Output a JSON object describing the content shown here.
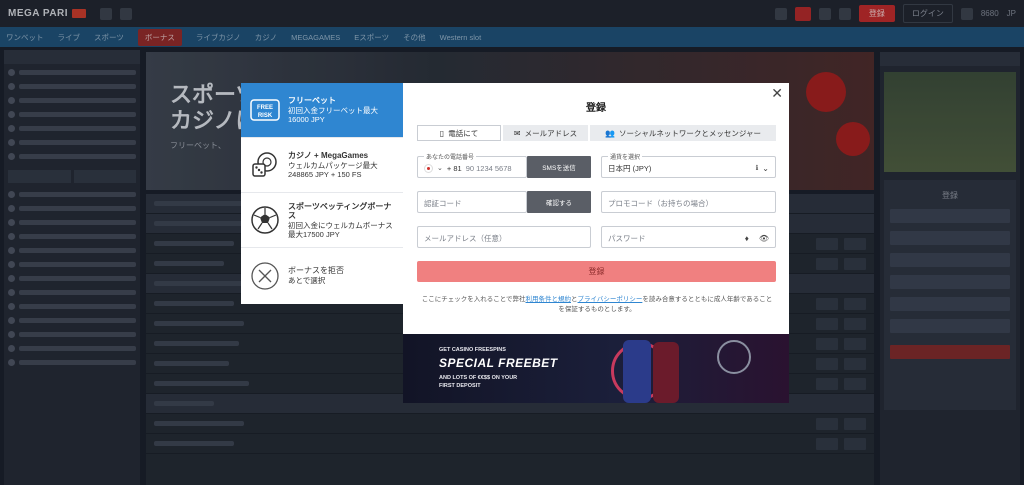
{
  "site": {
    "logo": "MEGA PARI",
    "topbar": {
      "register": "登録",
      "login": "ログイン",
      "currency": "8680",
      "lang": "JP"
    },
    "nav": [
      "ワンベット",
      "ライブ",
      "スポーツ",
      "ボーナス",
      "ライブカジノ",
      "カジノ",
      "MEGAGAMES",
      "Eスポーツ",
      "その他",
      "Western slot"
    ],
    "banner": {
      "title_line1": "スポーツ",
      "title_line2": "カジノに",
      "subtitle": "フリーベット、"
    },
    "right": {
      "title": "登録"
    }
  },
  "bonuses": [
    {
      "title": "フリーベット",
      "desc": "初回入金フリーベット最大 16000 JPY",
      "icon": "free-risk-icon"
    },
    {
      "title": "カジノ + MegaGames",
      "desc": "ウェルカムパッケージ最大 248865 JPY + 150 FS",
      "icon": "dice-chip-icon"
    },
    {
      "title": "スポーツベッティングボーナス",
      "desc": "初回入金にウェルカムボーナス最大17500 JPY",
      "icon": "soccer-ball-icon"
    },
    {
      "title": "ボーナスを拒否",
      "desc": "あとで選択",
      "icon": "decline-x-icon"
    }
  ],
  "register": {
    "title": "登録",
    "close": "✕",
    "tabs": [
      "電話にて",
      "メールアドレス",
      "ソーシャルネットワークとメッセンジャー"
    ],
    "phone": {
      "label": "あなたの電話番号",
      "code": "+ 81",
      "placeholder": "90 1234 5678"
    },
    "sms_button": "SMSを送信",
    "currency": {
      "label": "通貨を選択",
      "value": "日本円 (JPY)"
    },
    "confirm_code": {
      "placeholder": "認証コード"
    },
    "confirm_button": "確認する",
    "promo_code": {
      "placeholder": "プロモコード（お持ちの場合）"
    },
    "email": {
      "placeholder": "メールアドレス（任意）"
    },
    "password": {
      "placeholder": "パスワード"
    },
    "submit": "登録",
    "terms_pre": "ここにチェックを入れることで弊社",
    "terms_link1": "利用条件と規約",
    "terms_mid": "と",
    "terms_link2": "プライバシーポリシー",
    "terms_post": "を読み合意するとともに成人年齢であることを保証するものとします。"
  },
  "promo": {
    "kicker": "GET CASINO FREESPINS",
    "headline": "SPECIAL FREEBET",
    "line1": "AND LOTS OF €€$$ ON YOUR",
    "line2": "FIRST DEPOSIT"
  },
  "colors": {
    "accent_blue": "#2f86d1",
    "submit_pink": "#f08080",
    "nav_blue": "#1e4e73"
  }
}
